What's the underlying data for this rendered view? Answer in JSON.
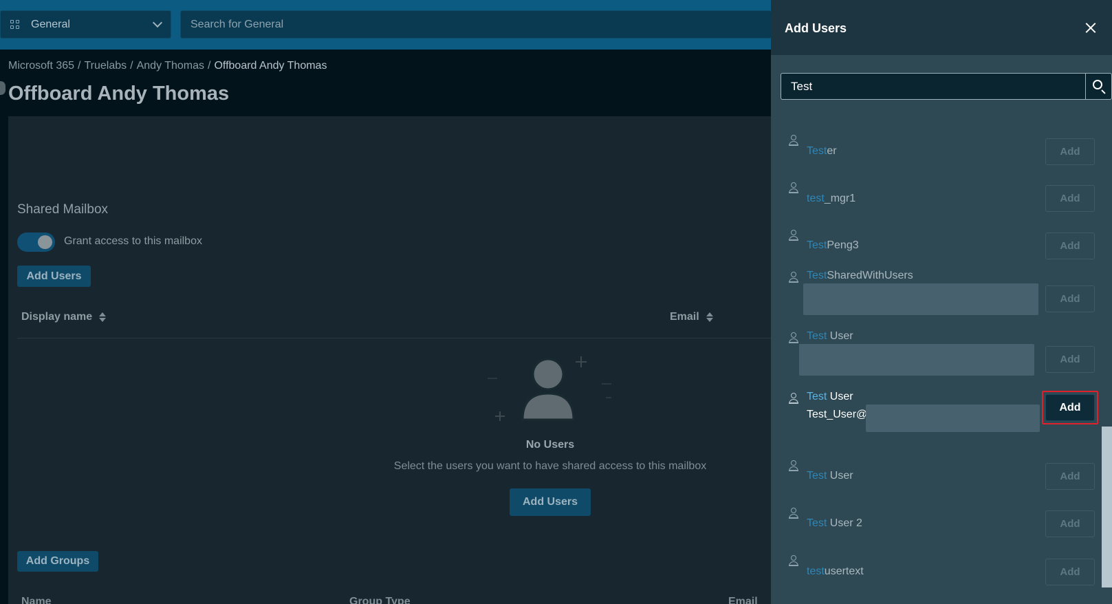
{
  "topbar": {
    "workspace": "General",
    "search_placeholder": "Search for General"
  },
  "breadcrumb": {
    "items": [
      "Microsoft 365",
      "Truelabs",
      "Andy Thomas"
    ],
    "current": "Offboard Andy Thomas",
    "separator": "/"
  },
  "page_title": "Offboard Andy Thomas",
  "shared_mailbox": {
    "section_title": "Shared Mailbox",
    "grant_access_label": "Grant access to this mailbox",
    "grant_access_enabled": true,
    "add_users_label": "Add Users",
    "columns": {
      "display_name": "Display name",
      "email": "Email"
    },
    "empty_title": "No Users",
    "empty_subtitle": "Select the users you want to have shared access to this mailbox",
    "empty_add_users_label": "Add Users"
  },
  "groups": {
    "add_groups_label": "Add Groups",
    "columns": {
      "name": "Name",
      "group_type": "Group Type",
      "email": "Email"
    }
  },
  "panel": {
    "title": "Add Users",
    "search_value": "Test",
    "results": [
      {
        "match": "Test",
        "rest": "er",
        "add_label": "Add"
      },
      {
        "match": "test",
        "rest": "_mgr1",
        "add_label": "Add"
      },
      {
        "match": "Test",
        "rest": "Peng3",
        "add_label": "Add"
      },
      {
        "match": "Test",
        "rest": "SharedWithUsers",
        "add_label": "Add"
      },
      {
        "match": "Test",
        "rest": " User",
        "add_label": "Add"
      },
      {
        "match": "Test",
        "rest": " User",
        "email": "Test_User@",
        "add_label": "Add"
      },
      {
        "match": "Test",
        "rest": " User",
        "add_label": "Add"
      },
      {
        "match": "Test",
        "rest": " User 2",
        "add_label": "Add"
      },
      {
        "match": "test",
        "rest": "usertext",
        "add_label": "Add"
      }
    ]
  },
  "colors": {
    "topbar": "#0b5b82",
    "panel_bg": "#2f4954",
    "highlight": "#2e86b6",
    "focus_ring": "#e0202a"
  }
}
